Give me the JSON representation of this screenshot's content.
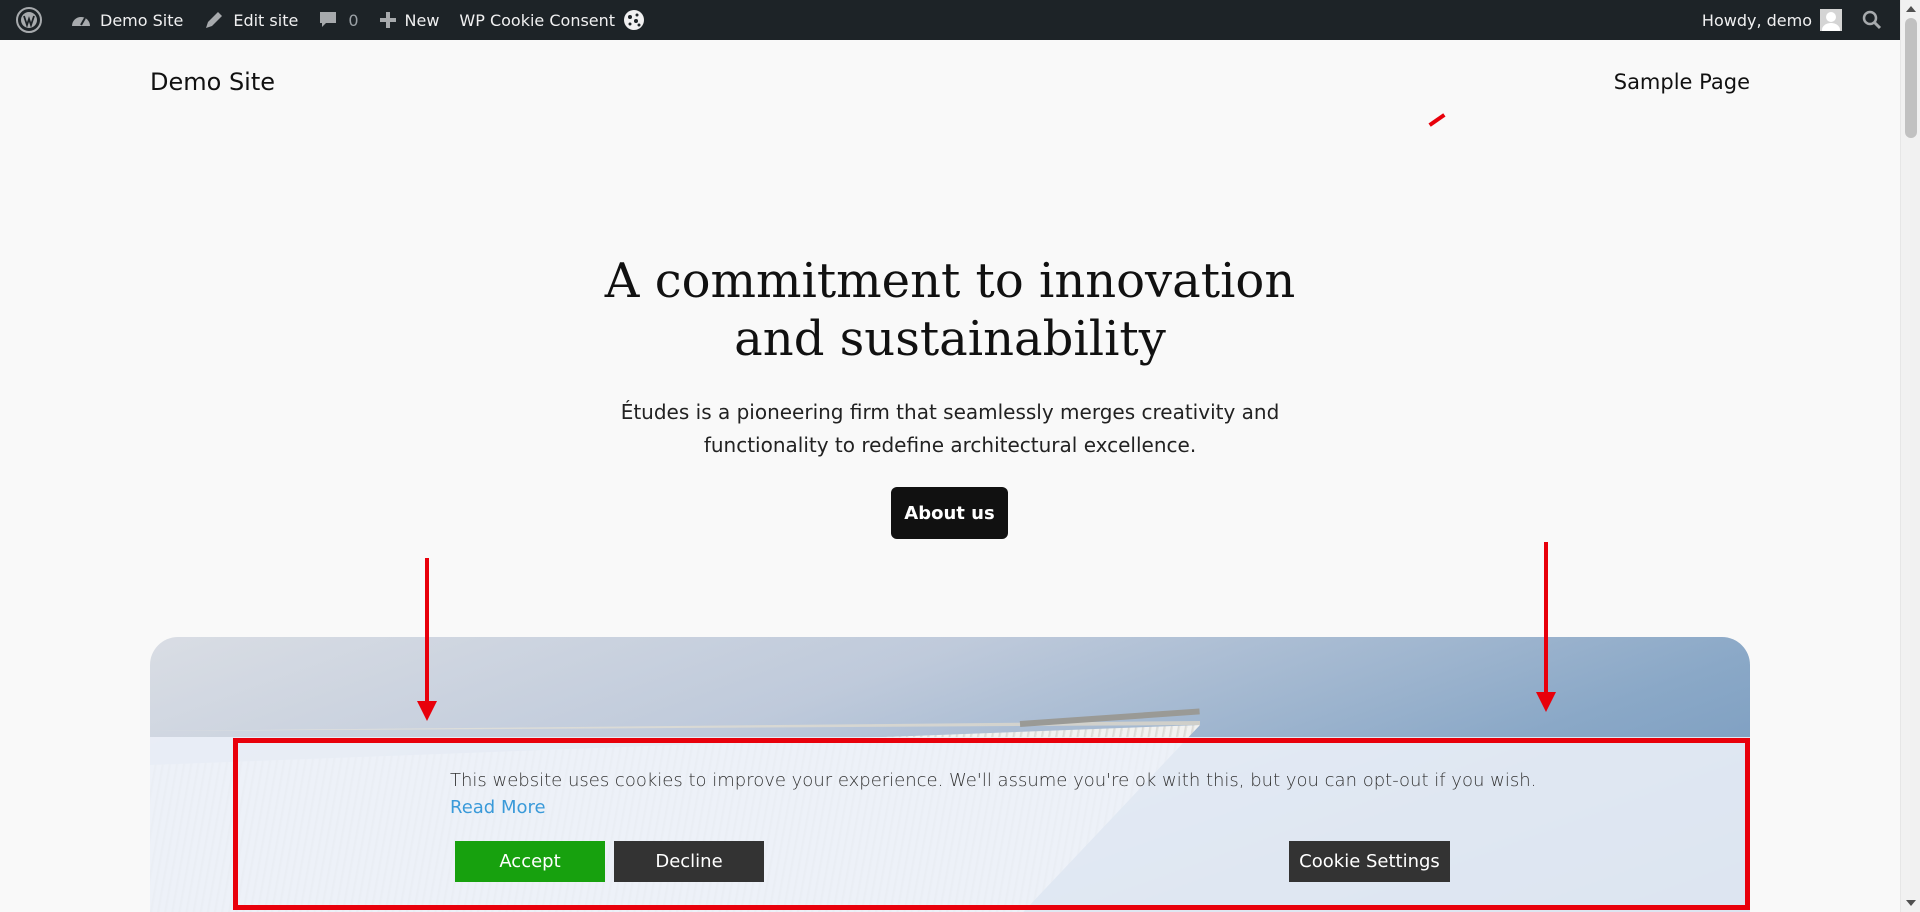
{
  "adminbar": {
    "site_name": "Demo Site",
    "edit_site": "Edit site",
    "comments_count": "0",
    "new_label": "New",
    "plugin_label": "WP Cookie Consent",
    "howdy": "Howdy, demo"
  },
  "header": {
    "site_title": "Demo Site",
    "nav_item": "Sample Page"
  },
  "hero": {
    "title_line1": "A commitment to innovation",
    "title_line2": "and sustainability",
    "desc_line1": "Études is a pioneering firm that seamlessly merges creativity and",
    "desc_line2": "functionality to redefine architectural excellence.",
    "button": "About us"
  },
  "cookie": {
    "message": "This website uses cookies to improve your experience. We'll assume you're ok with this, but you can opt-out if you wish.",
    "read_more": "Read More",
    "accept": "Accept",
    "decline": "Decline",
    "settings": "Cookie Settings"
  },
  "colors": {
    "adminbar_bg": "#1d2327",
    "accept_bg": "#17a10e",
    "decline_bg": "#333333",
    "link": "#3a9ad9",
    "annotation": "#e8000b"
  },
  "icons": [
    "wordpress-icon",
    "dashboard-icon",
    "edit-icon",
    "comment-icon",
    "plus-icon",
    "cookie-icon",
    "search-icon"
  ]
}
